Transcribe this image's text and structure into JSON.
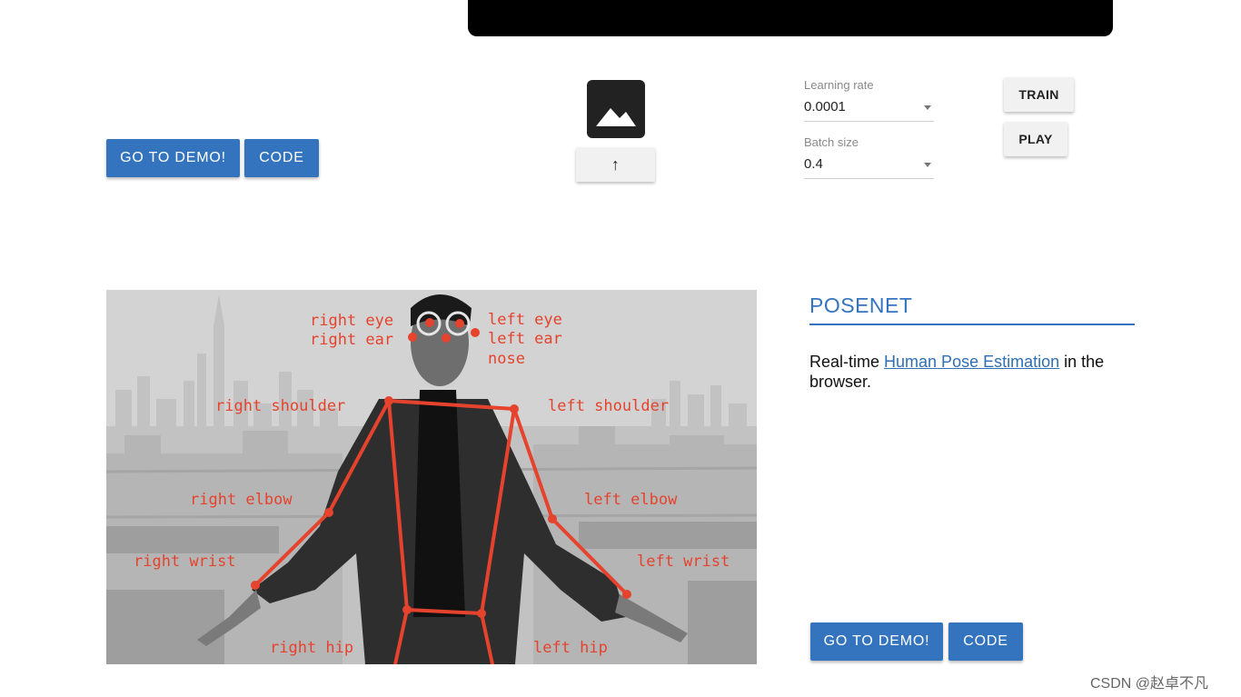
{
  "top_buttons": {
    "demo_label": "GO TO DEMO!",
    "code_label": "CODE"
  },
  "controls": {
    "upload_arrow": "↑",
    "learning_rate": {
      "label": "Learning rate",
      "value": "0.0001"
    },
    "batch_size": {
      "label": "Batch size",
      "value": "0.4"
    },
    "train_label": "TRAIN",
    "play_label": "PLAY"
  },
  "posenet": {
    "title": "POSENET",
    "desc_prefix": "Real-time ",
    "desc_link": "Human Pose Estimation",
    "desc_suffix": " in the browser.",
    "demo_label": "GO TO DEMO!",
    "code_label": "CODE"
  },
  "keypoint_labels": {
    "right_eye": "right eye",
    "right_ear": "right ear",
    "left_eye": "left eye",
    "left_ear": "left ear",
    "nose": "nose",
    "right_shoulder": "right shoulder",
    "left_shoulder": "left shoulder",
    "right_elbow": "right elbow",
    "left_elbow": "left elbow",
    "right_wrist": "right wrist",
    "left_wrist": "left wrist",
    "right_hip": "right hip",
    "left_hip": "left hip"
  },
  "watermark": "CSDN @赵卓不凡",
  "colors": {
    "primary": "#3474bf",
    "skeleton": "#e5432d"
  }
}
